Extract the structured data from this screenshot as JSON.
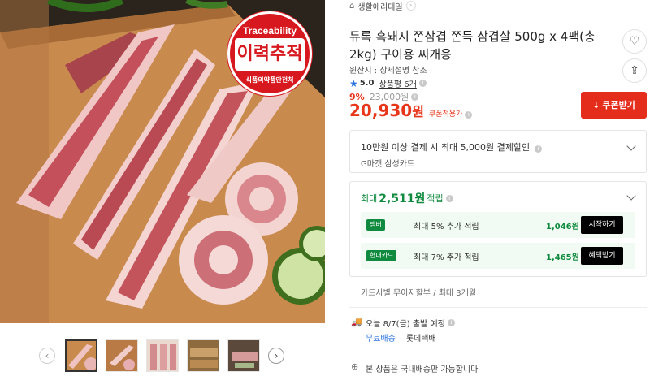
{
  "hero": {
    "badge_top": "Traceability",
    "badge_main": "이력추적",
    "badge_bottom": "식품의약품안전처"
  },
  "gallery": {
    "prev_icon": "‹",
    "next_icon": "›",
    "thumbnail_count": 5,
    "active_index": 0
  },
  "breadcrumb": {
    "home_icon": "⌂",
    "label": "생활에리데일",
    "arrow": "›"
  },
  "product": {
    "title": "듀록 흑돼지 쫀삼겹 쫀득 삼겹살 500g x 4팩(총 2kg) 구이용 찌개용",
    "origin": "원산지 : 상세설명 참조",
    "rating_icon": "★",
    "rating": "5.0",
    "reviews": "상품평 6개",
    "info_icon": "i",
    "discount_pct": "9%",
    "original_price": "23,000원",
    "price": "20,930",
    "price_unit": "원",
    "price_note": "쿠폰적용가",
    "coupon_button": "쿠폰받기",
    "download_icon": "↓",
    "heart_icon": "♡",
    "share_icon": "⇪"
  },
  "card_offer": {
    "line1": "10만원 이상 결제 시 최대 5,000원 결제할인",
    "line2": "G마켓 삼성카드"
  },
  "rewards": {
    "head_prefix": "최대",
    "head_amount": "2,511원",
    "head_suffix": "적립",
    "items": [
      {
        "badge": "멤버",
        "text": "최대 5% 추가 적립",
        "amount": "1,046원",
        "button": "시작하기"
      },
      {
        "badge": "현대카드",
        "text": "최대 7% 추가 적립",
        "amount": "1,465원",
        "button": "혜택받기"
      }
    ]
  },
  "installment": "카드사별 무이자할부 / 최대 3개월",
  "shipping": {
    "truck_icon": "🚚",
    "eta": "오늘 8/7(금) 출발 예정",
    "free": "무료배송",
    "courier": "롯데택배"
  },
  "domestic": {
    "globe_icon": "⊕",
    "text": "본 상품은 국내배송만 가능합니다"
  },
  "colors": {
    "accent_red": "#e8361b",
    "reward_green": "#0f8a3e",
    "link_blue": "#2d73e0"
  }
}
